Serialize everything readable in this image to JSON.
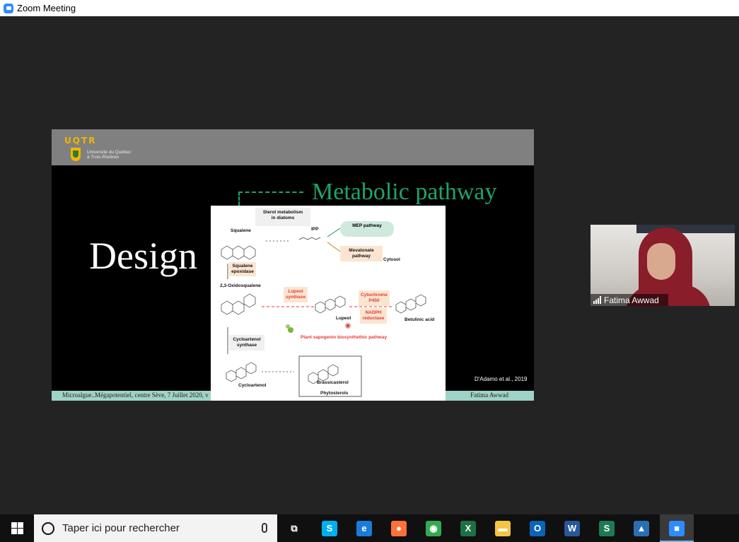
{
  "window": {
    "title": "Zoom Meeting",
    "icon": "zoom-icon"
  },
  "slide": {
    "logo_text": "UQTR",
    "university": [
      "Université du Québec",
      "à Trois-Rivières"
    ],
    "big_word": "Design",
    "heading": "Metabolic pathway",
    "reference": "D'Adamo et al., 2019",
    "footer_left": "Microalgue..Mégapotentiel, centre Sève, 7 Juillet 2020, v",
    "footer_right": "Fatima Awwad"
  },
  "figure": {
    "title": [
      "Sterol metabolism",
      "in diatoms"
    ],
    "squalene": "Squalene",
    "ipp": "IPP",
    "mep": "MEP pathway",
    "mevalonate": [
      "Mevalonate",
      "pathway"
    ],
    "cytosol": "Cytosol",
    "squalene_epoxidase": [
      "Squalene",
      "epoxidase"
    ],
    "oxidosqualene": "2,3-Oxidosqualene",
    "lupeol_synthase": [
      "Lupeol",
      "synthase"
    ],
    "cytochrome": [
      "Cytochrome",
      "P450"
    ],
    "nadph": [
      "NADPH",
      "reductase"
    ],
    "lupeol": "Lupeol",
    "betulinic": "Betulinic acid",
    "sapogenin": "Plant sapogenin biosynthethic pathway",
    "cycloartenol_synthase": [
      "Cycloartenol",
      "synthase"
    ],
    "cycloartenol": "Cycloartenol",
    "brassicasterol": "Brassicasterol",
    "phytosterols": "Phytosterols"
  },
  "participant": {
    "name": "Fatima Awwad",
    "signal_icon": "signal-bars-icon"
  },
  "taskbar": {
    "search_placeholder": "Taper ici pour rechercher",
    "apps": [
      {
        "name": "task-view",
        "glyph": "⧉",
        "color": "#101010"
      },
      {
        "name": "skype",
        "glyph": "S",
        "color": "#00aff0"
      },
      {
        "name": "edge",
        "glyph": "e",
        "color": "#1b7bd8"
      },
      {
        "name": "firefox",
        "glyph": "●",
        "color": "#ff7139"
      },
      {
        "name": "chrome",
        "glyph": "◉",
        "color": "#34a853"
      },
      {
        "name": "excel",
        "glyph": "X",
        "color": "#1d7044"
      },
      {
        "name": "file-explorer",
        "glyph": "▬",
        "color": "#f4c542"
      },
      {
        "name": "outlook",
        "glyph": "O",
        "color": "#0a64b8"
      },
      {
        "name": "word",
        "glyph": "W",
        "color": "#2b5797"
      },
      {
        "name": "sway",
        "glyph": "S",
        "color": "#1e7a55"
      },
      {
        "name": "photos",
        "glyph": "▲",
        "color": "#2a6fb0"
      },
      {
        "name": "zoom",
        "glyph": "■",
        "color": "#2D8CFF"
      }
    ]
  }
}
